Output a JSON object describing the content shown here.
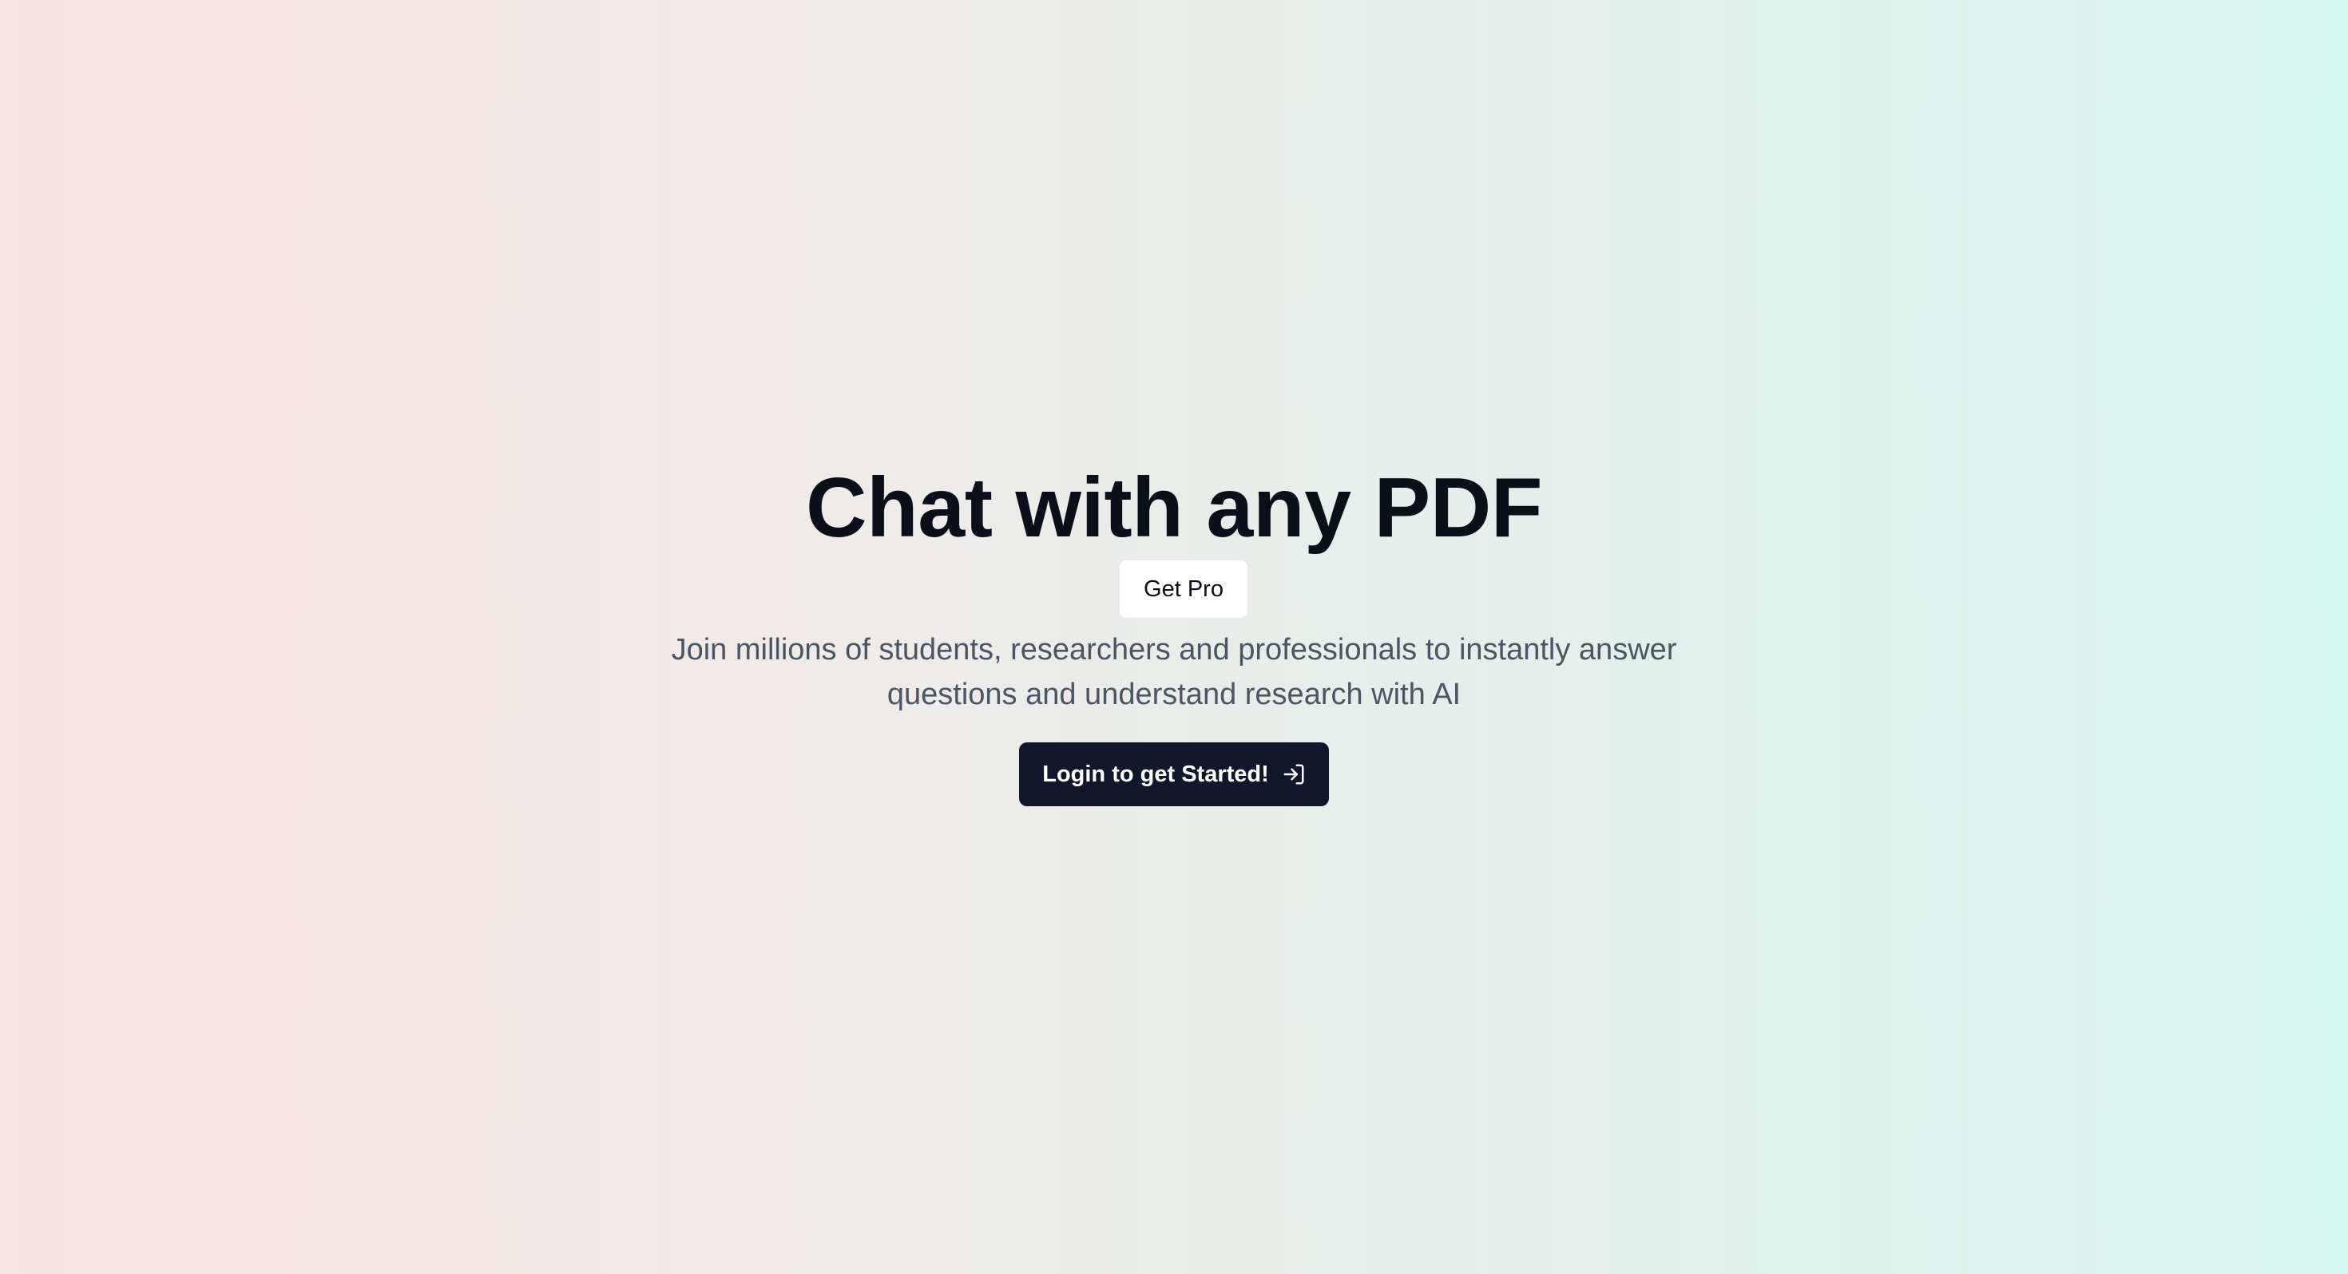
{
  "hero": {
    "title": "Chat with any PDF",
    "get_pro_label": "Get Pro",
    "subtitle": "Join millions of students, researchers and professionals to instantly answer questions and understand research with AI",
    "cta_label": "Login to get Started!",
    "cta_icon": "log-in-icon"
  },
  "colors": {
    "gradient_left": "#fbe2e3",
    "gradient_right": "#d6f7ee",
    "title": "#0b0f1a",
    "subtitle": "#4b5563",
    "cta_background": "#11162a",
    "cta_text": "#ffffff"
  }
}
